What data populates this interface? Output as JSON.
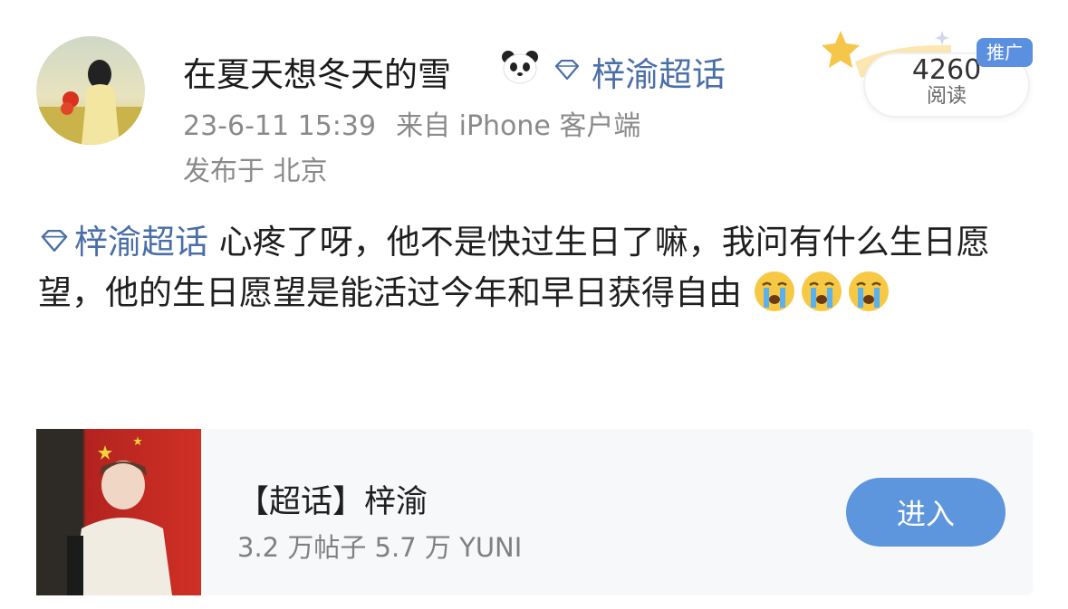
{
  "post": {
    "username": "在夏天想冬天的雪",
    "username_emoji": "panda-emoji",
    "super_topic": "梓渝超话",
    "timestamp": "23-6-11 15:39",
    "source": "来自 iPhone 客户端",
    "location": "发布于 北京",
    "reads_count": "4260",
    "reads_label": "阅读",
    "promo_tag": "推广",
    "body_topic": "梓渝超话",
    "body_text": " 心疼了呀，他不是快过生日了嘛，我问有什么生日愿望，他的生日愿望是能活过今年和早日获得自由",
    "body_emojis": [
      "crying-face",
      "crying-face",
      "crying-face"
    ]
  },
  "card": {
    "title": "【超话】梓渝",
    "stats": "3.2 万帖子 5.7 万 YUNI",
    "button_label": "进入"
  },
  "colors": {
    "topic_blue": "#4a6fa8",
    "button_blue": "#5d96dc",
    "meta_gray": "#8a8a8a",
    "promo_blue": "#5b8fe0"
  }
}
